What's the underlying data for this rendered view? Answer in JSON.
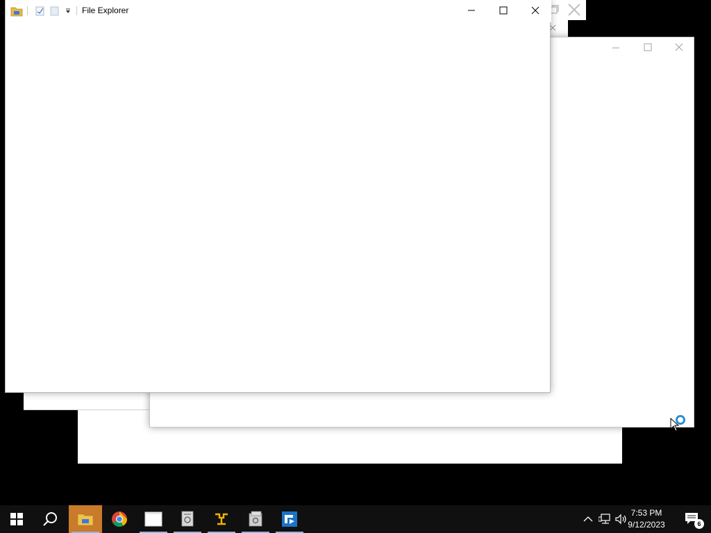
{
  "front_window": {
    "title": "File Explorer",
    "controls": [
      "minimize-icon",
      "maximize-icon",
      "close-icon"
    ]
  },
  "background_windows": [
    {
      "name": "window-top-right",
      "controls": [
        "maximize-icon",
        "close-icon"
      ]
    },
    {
      "name": "window-right",
      "controls": [
        "minimize-icon",
        "maximize-icon",
        "close-icon"
      ]
    },
    {
      "name": "window-bottom-left"
    },
    {
      "name": "window-bottom-center"
    }
  ],
  "taskbar": {
    "start_icon": "windows-logo-icon",
    "search_icon": "search-icon",
    "apps": [
      {
        "name": "file-explorer",
        "icon": "folder-icon",
        "active": true
      },
      {
        "name": "chrome",
        "icon": "chrome-icon",
        "active": false
      },
      {
        "name": "blank-window",
        "icon": "window-icon",
        "active": false
      },
      {
        "name": "app-settings",
        "icon": "gear-doc-icon",
        "active": false
      },
      {
        "name": "network-tool",
        "icon": "network-icon",
        "active": false
      },
      {
        "name": "app-manager",
        "icon": "server-icon",
        "active": false
      },
      {
        "name": "remote-app",
        "icon": "remote-icon",
        "active": false
      }
    ],
    "tray": {
      "chevron_icon": "chevron-up-icon",
      "network_icon": "network-status-icon",
      "volume_icon": "volume-icon"
    },
    "time": "7:53 PM",
    "date": "9/12/2023",
    "notifications_count": "6"
  },
  "colors": {
    "desktop": "#000000",
    "taskbar": "#101010",
    "active_app": "#c97a2a",
    "accent_underline": "#8fb4e6"
  }
}
